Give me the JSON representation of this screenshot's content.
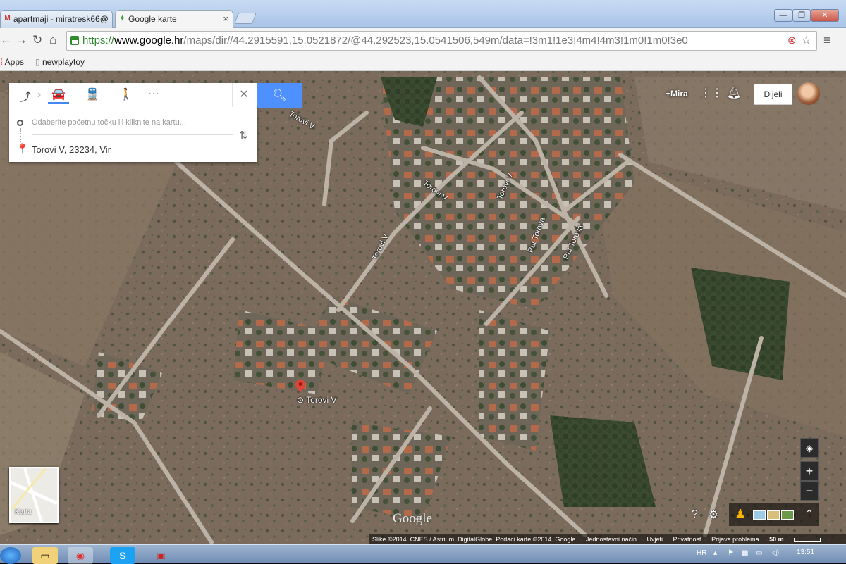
{
  "browser": {
    "tabs": [
      {
        "title": "apartmaji - miratresk66@",
        "icon": "gmail-icon"
      },
      {
        "title": "Google karte",
        "icon": "google-maps-icon"
      }
    ],
    "url": {
      "scheme": "https://",
      "host": "www.google.hr",
      "path": "/maps/dir//44.2915591,15.0521872/@44.292523,15.0541506,549m/data=!3m1!1e3!4m4!4m3!1m0!1m0!3e0"
    },
    "bookmarks": [
      {
        "label": "Apps"
      },
      {
        "label": "newplaytoy"
      }
    ]
  },
  "directions": {
    "modes": [
      "directions-icon",
      "car-icon",
      "transit-icon",
      "walking-icon",
      "more-icon"
    ],
    "selected_mode": "car-icon",
    "start_placeholder": "Odaberite početnu točku ili kliknite na kartu...",
    "destination": "Torovi V, 23234, Vir"
  },
  "account": {
    "plus_name": "+Mira",
    "share_label": "Dijeli"
  },
  "map": {
    "pin_label": "Torovi V",
    "road_labels": [
      "Torovi V",
      "Torovi V",
      "Torovi V",
      "Torovi V",
      "Put Torova",
      "Put Torova"
    ],
    "thumbnail_label": "Karta",
    "logo": "Google"
  },
  "attribution": {
    "imagery": "Slike ©2014. CNES / Astrium, DigitalGlobe, Podaci karte ©2014. Google",
    "lite_mode": "Jednostavni način",
    "terms": "Uvjeti",
    "privacy": "Privatnost",
    "report": "Prijava problema",
    "scale": "50 m"
  },
  "taskbar": {
    "language": "HR",
    "time": "13:51"
  },
  "colors": {
    "accent": "#4285f4",
    "pin": "#db4437",
    "https": "#2e8b2e"
  }
}
